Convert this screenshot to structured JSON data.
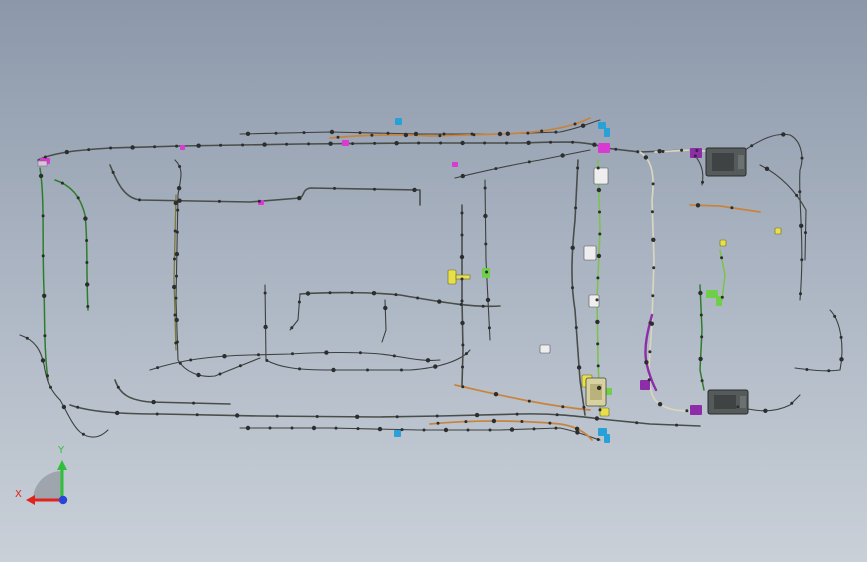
{
  "view": {
    "background_top": "#8c98aa",
    "background_bottom": "#c9d0d8"
  },
  "harness": {
    "wire_colors": {
      "main": "#4a4e4a",
      "green": "#2f7d2c",
      "orange": "#c8843c",
      "light": "#d8d6bc",
      "purple": "#8e2da8",
      "connector_blue": "#2aa0d8",
      "connector_magenta": "#d93ad1",
      "connector_yellow": "#e8e04a",
      "module_gray": "#555a5a"
    }
  },
  "triad": {
    "x_label": "X",
    "y_label": "Y",
    "x_color": "#e0241d",
    "y_color": "#2fbf3a",
    "z_color": "#2b44d8"
  }
}
